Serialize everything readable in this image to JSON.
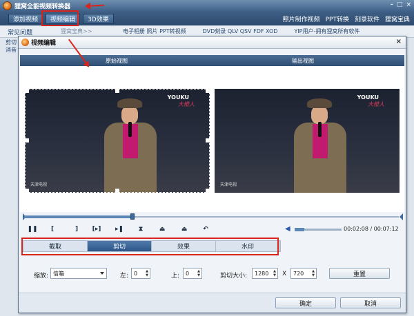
{
  "app": {
    "title": "狸窝全能视频转换器",
    "window_buttons": [
      "–",
      "□",
      "×"
    ]
  },
  "menu": {
    "tabs": [
      "添加视频",
      "视频编辑",
      "3D效果"
    ],
    "right_items": [
      "照片制作视频",
      "PPT转换",
      "刻录软件",
      "狸窝宝典"
    ]
  },
  "subbar": {
    "faq": "常见问题",
    "banner_tab": "狸窝宝典>>",
    "banner_items": [
      "电子相册 照片 PPT转视频",
      "DVD刻录 QLV QSV FDF XOD",
      "YIP用户-拥有狸窝所有软件"
    ]
  },
  "sidebar": {
    "bits": [
      "剪切",
      "消音"
    ]
  },
  "dialog": {
    "title": "视频编辑",
    "close": "×",
    "view_original": "原始视图",
    "view_output": "输出视图",
    "watermark_top": "YOUKU",
    "watermark_script": "大橙人",
    "stage_logo": "天津电视"
  },
  "player": {
    "progress": 0.29,
    "volume": 0.2,
    "time": "00:02:08 / 00:07:12",
    "buttons": [
      "❚❚",
      "[",
      "]",
      "[▸]",
      "▸❚",
      "⧗",
      "⏏",
      "⏏",
      "↶"
    ]
  },
  "tabs": [
    {
      "label": "截取",
      "active": false
    },
    {
      "label": "剪切",
      "active": true
    },
    {
      "label": "效果",
      "active": false
    },
    {
      "label": "水印",
      "active": false
    }
  ],
  "settings": {
    "zoom_label": "缩放:",
    "zoom_value": "信箱",
    "left_label": "左:",
    "left_value": "0",
    "top_label": "上:",
    "top_value": "0",
    "crop_size_label": "剪切大小:",
    "crop_width": "1280",
    "x_sep": "X",
    "crop_height": "720",
    "reset_button": "重置"
  },
  "footer": {
    "ok_button": "确定",
    "cancel_button": "取消"
  },
  "colors": {
    "accent": "#2d5689",
    "highlight": "#d9241b"
  }
}
